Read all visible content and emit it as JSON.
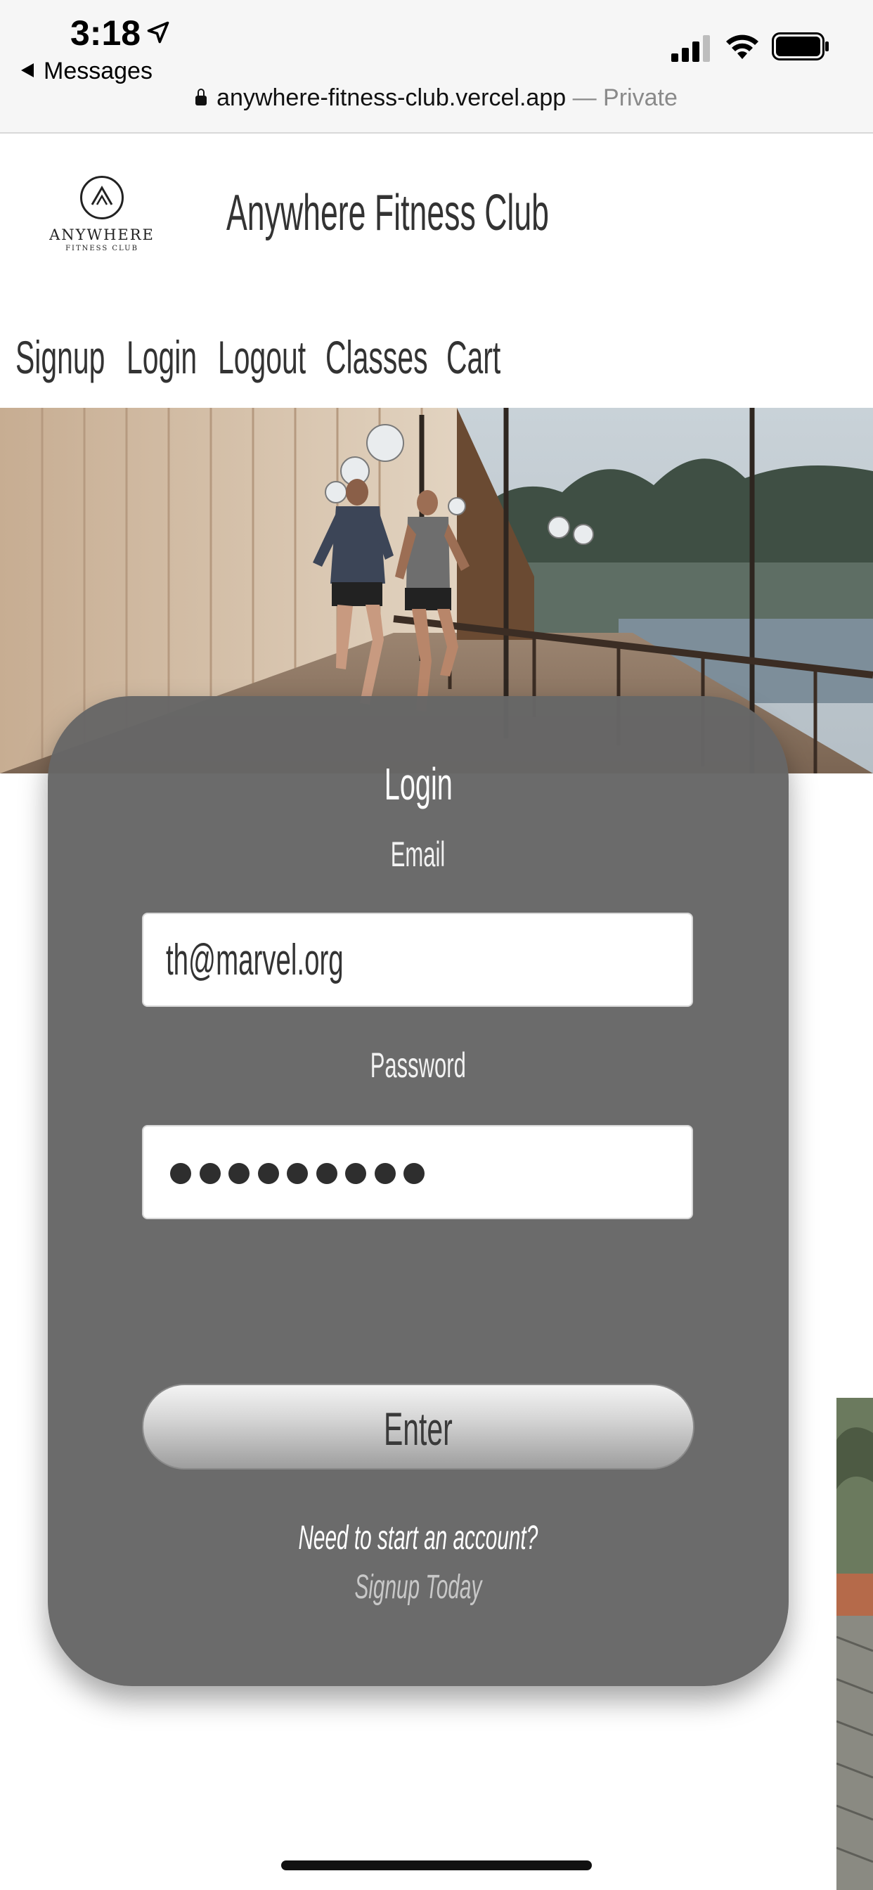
{
  "status_bar": {
    "time": "3:18",
    "back_label": "Messages",
    "icons": [
      "location-arrow-icon",
      "cellular-signal-icon",
      "wifi-icon",
      "battery-icon"
    ]
  },
  "browser": {
    "url": "anywhere-fitness-club.vercel.app",
    "private_label": " — Private"
  },
  "header": {
    "logo_text": "ANYWHERE",
    "logo_sub": "FITNESS CLUB",
    "site_title": "Anywhere Fitness Club"
  },
  "nav": {
    "items": [
      {
        "label": "Signup"
      },
      {
        "label": "Login"
      },
      {
        "label": "Logout"
      },
      {
        "label": "Classes"
      },
      {
        "label": "Cart"
      }
    ]
  },
  "login": {
    "title": "Login",
    "email_label": "Email",
    "email_value": "th@marvel.org",
    "password_label": "Password",
    "password_masked_count": 9,
    "enter_label": "Enter",
    "prompt": "Need to start an account?",
    "signup_link": "Signup Today"
  },
  "colors": {
    "card_bg": "#666666",
    "text_dark": "#333333",
    "link_muted": "#c8c8c8"
  }
}
